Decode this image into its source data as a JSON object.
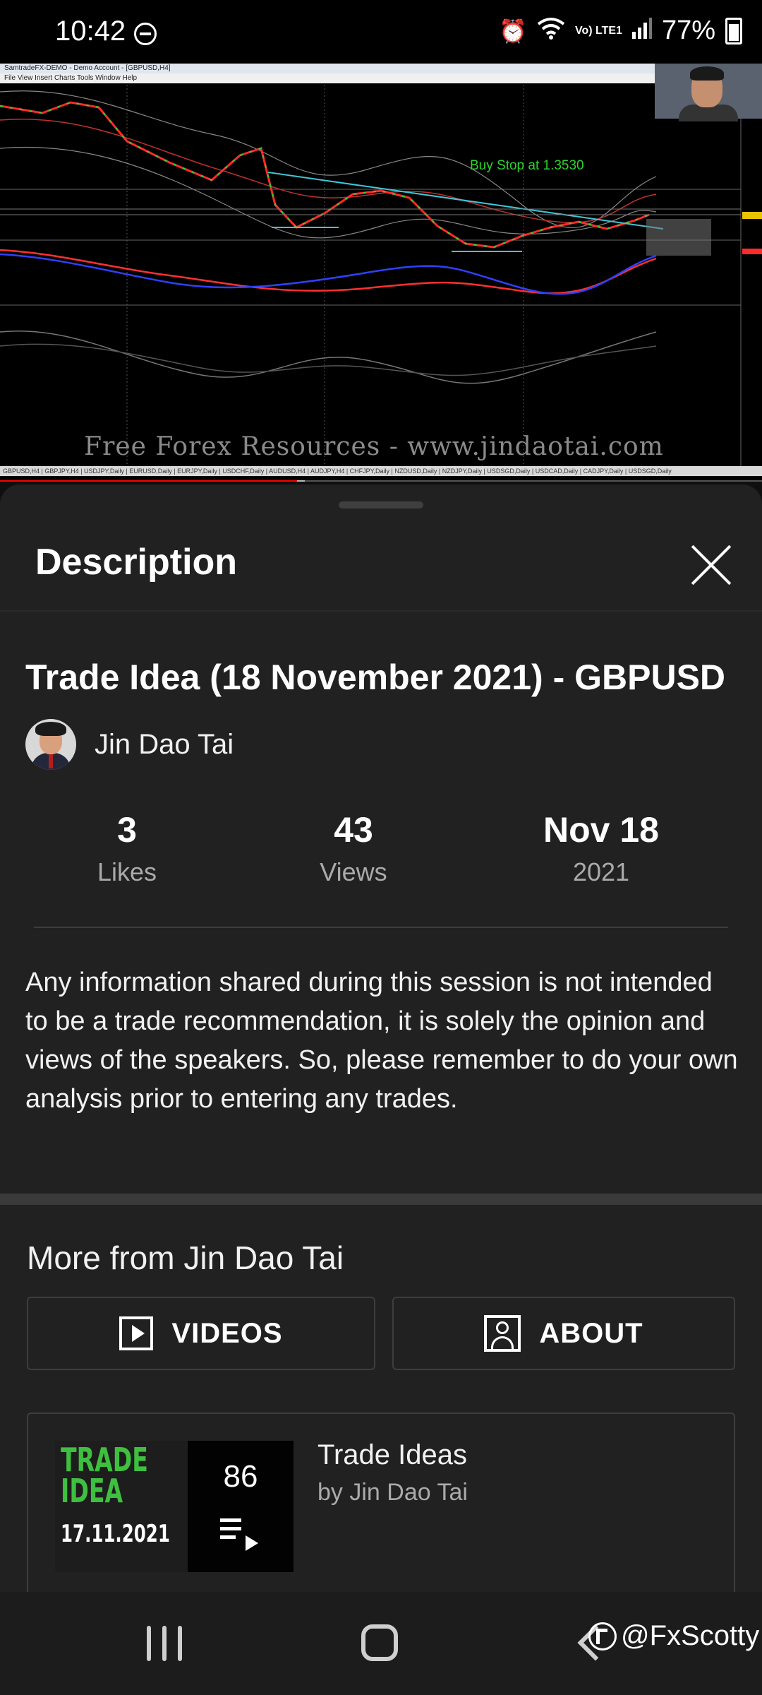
{
  "status_bar": {
    "time": "10:42",
    "dnd_icon": "do-not-disturb-icon",
    "alarm_icon": "alarm-icon",
    "wifi_icon": "wifi-icon",
    "network_label": "Vo) LTE1",
    "signal_icon": "signal-icon",
    "battery": "77%",
    "battery_icon": "battery-icon"
  },
  "video": {
    "watermark": "Free Forex Resources - www.jindaotai.com",
    "annotation": "Buy Stop at 1.3530",
    "platform_title": "SamtradeFX-DEMO - Demo Account - [GBPUSD,H4]",
    "platform_menu": "File  View  Insert  Charts  Tools  Window  Help",
    "symbol_tabs": "GBPUSD,H4 | GBPJPY,H4 | USDJPY,Daily | EURUSD,Daily | EURJPY,Daily | USDCHF,Daily | AUDUSD,H4 | AUDJPY,H4 | CHFJPY,Daily | NZDUSD,Daily | NZDJPY,Daily | USDSGD,Daily | USDCAD,Daily | CADJPY,Daily | USDSGD,Daily",
    "progress_fraction": 0.39,
    "buffer_fraction": 0.4,
    "colors": {
      "progress": "#ff0000",
      "bull_candle": "#2bd42b",
      "bear_candle": "#ff2020",
      "trendline": "#3fc6d6"
    }
  },
  "sheet": {
    "title": "Description",
    "close_icon": "close-icon",
    "video_title": "Trade Idea (18 November 2021) - GBPUSD",
    "channel_name": "Jin Dao Tai",
    "stats": {
      "likes_value": "3",
      "likes_label": "Likes",
      "views_value": "43",
      "views_label": "Views",
      "date_value": "Nov 18",
      "date_label": "2021"
    },
    "description": "Any information shared during this session is not intended to be a trade recommendation, it is solely the opinion and views of the speakers. So, please remember to do your own analysis prior to entering any trades.",
    "more_from": "More from Jin Dao Tai",
    "videos_button": "VIDEOS",
    "videos_icon": "play-box-icon",
    "about_button": "ABOUT",
    "about_icon": "person-box-icon",
    "playlist": {
      "thumb_line1": "TRADE",
      "thumb_line2": "IDEA",
      "thumb_date": "17.11.2021",
      "count": "86",
      "queue_icon": "playlist-play-icon",
      "title": "Trade Ideas",
      "byline": "by Jin Dao Tai"
    }
  },
  "nav_bar": {
    "recent_icon": "recent-apps-icon",
    "home_icon": "home-icon",
    "back_icon": "back-icon",
    "watermark_handle": "@FxScotty"
  }
}
